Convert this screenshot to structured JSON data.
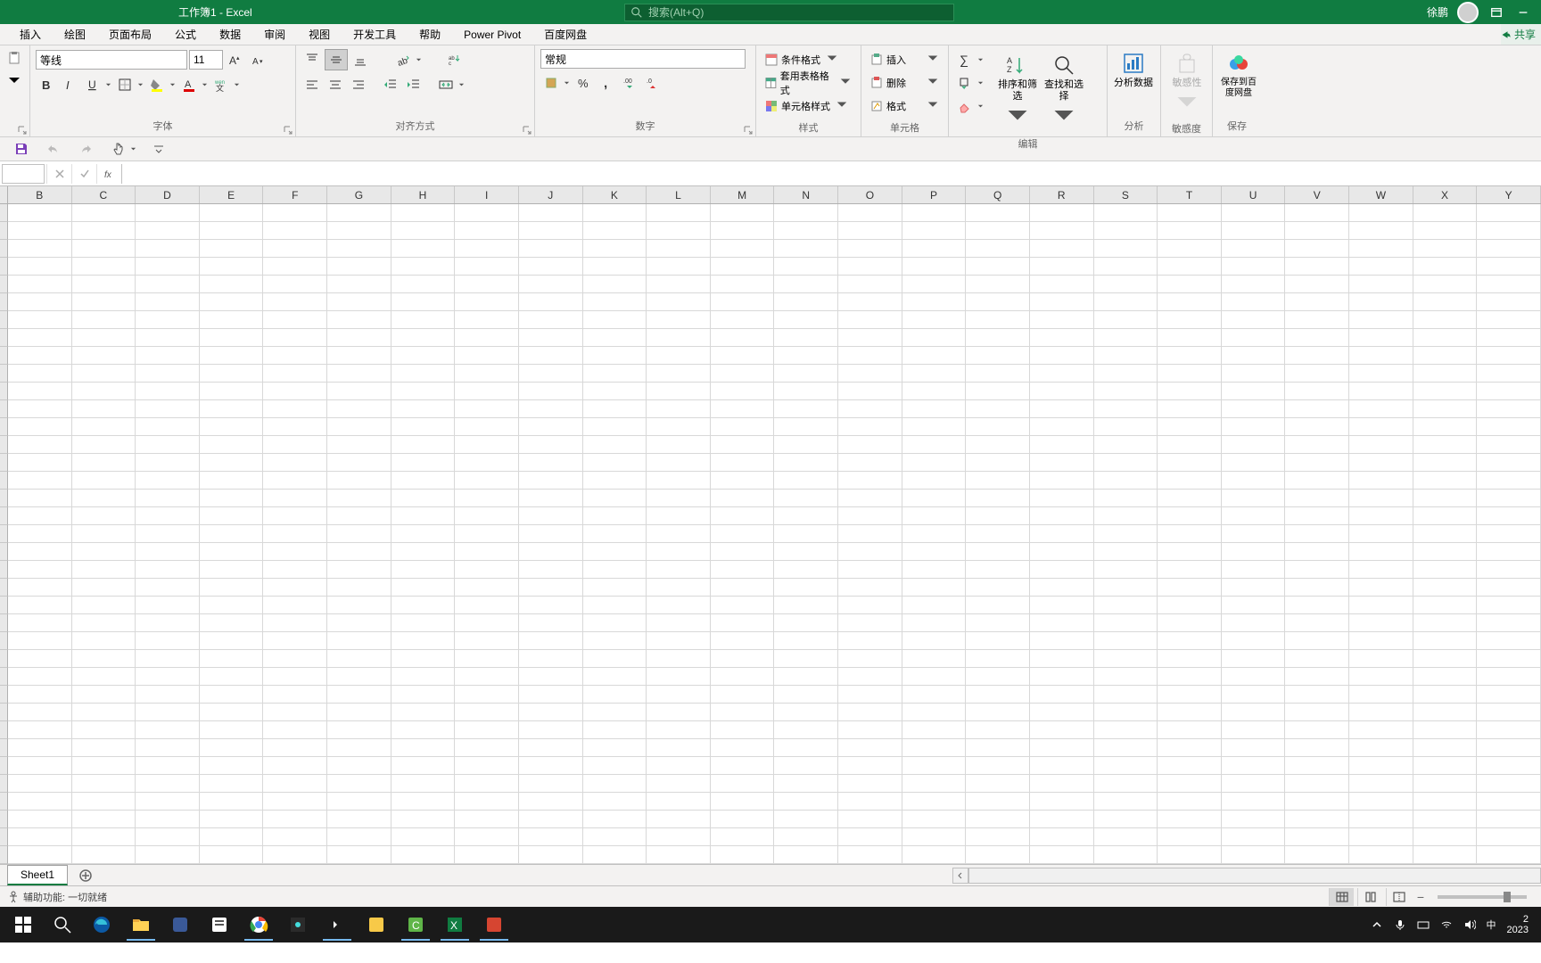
{
  "titlebar": {
    "doc_name": "工作簿1",
    "app_name": "Excel",
    "search_placeholder": "搜索(Alt+Q)",
    "user_name": "徐鹏"
  },
  "tabs": {
    "items": [
      "插入",
      "绘图",
      "页面布局",
      "公式",
      "数据",
      "审阅",
      "视图",
      "开发工具",
      "帮助",
      "Power Pivot",
      "百度网盘"
    ],
    "share": "共享"
  },
  "font_group": {
    "label": "字体",
    "font_name": "等线",
    "font_size": "11",
    "wen_label": "wen"
  },
  "align_group": {
    "label": "对齐方式"
  },
  "number_group": {
    "label": "数字",
    "format": "常规"
  },
  "styles_group": {
    "label": "样式",
    "conditional": "条件格式",
    "table": "套用表格格式",
    "cell": "单元格样式"
  },
  "cells_group": {
    "label": "单元格",
    "insert": "插入",
    "delete": "删除",
    "format": "格式"
  },
  "editing_group": {
    "label": "编辑",
    "sort": "排序和筛选",
    "find": "查找和选择"
  },
  "analysis_group": {
    "label": "分析",
    "analyze": "分析数据"
  },
  "sensitivity_group": {
    "label": "敏感度",
    "btn": "敏感性"
  },
  "save_group": {
    "label": "保存",
    "btn": "保存到百度网盘"
  },
  "columns": [
    "B",
    "C",
    "D",
    "E",
    "F",
    "G",
    "H",
    "I",
    "J",
    "K",
    "L",
    "M",
    "N",
    "O",
    "P",
    "Q",
    "R",
    "S",
    "T",
    "U",
    "V",
    "W",
    "X",
    "Y"
  ],
  "sheet_tabs": {
    "sheet1": "Sheet1"
  },
  "status": {
    "accessibility": "辅助功能: 一切就绪"
  },
  "tray": {
    "ime": "中",
    "year": "2023"
  }
}
